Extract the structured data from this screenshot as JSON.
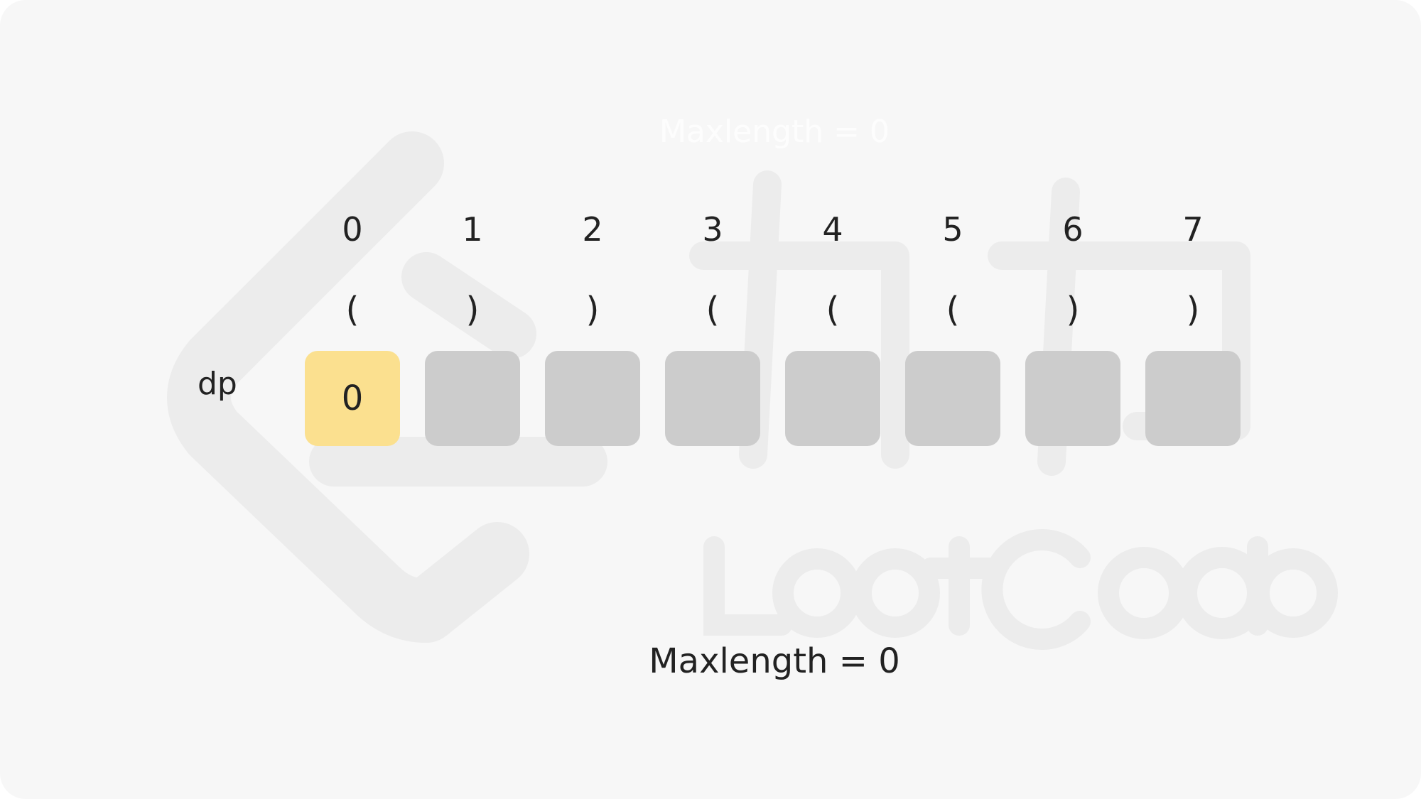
{
  "diagram": {
    "row_label": "dp",
    "indices": [
      "0",
      "1",
      "2",
      "3",
      "4",
      "5",
      "6",
      "7"
    ],
    "chars": [
      "(",
      ")",
      ")",
      "(",
      "(",
      "(",
      ")",
      ")"
    ],
    "dp_values": [
      "0",
      "",
      "",
      "",
      "",
      "",
      "",
      ""
    ],
    "active_index": 0,
    "maxlength_text": "Maxlength = 0",
    "ghost_text": "Maxlength = 0"
  },
  "colors": {
    "background": "#f7f7f7",
    "box_default": "#cccccc",
    "box_active": "#fbe08f",
    "text": "#222222"
  }
}
